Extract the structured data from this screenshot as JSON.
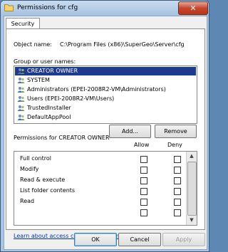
{
  "window": {
    "title": "Permissions for cfg",
    "close_label": "✕"
  },
  "tabs": [
    {
      "label": "Security"
    }
  ],
  "object": {
    "label": "Object name:",
    "value": "C:\\Program Files (x86)\\SuperGeo\\Server\\cfg"
  },
  "groups": {
    "label": "Group or user names:",
    "items": [
      {
        "label": "CREATOR OWNER",
        "icon": "user-group-icon",
        "selected": true
      },
      {
        "label": "SYSTEM",
        "icon": "user-group-icon",
        "selected": false
      },
      {
        "label": "Administrators (EPEI-2008R2-VM\\Administrators)",
        "icon": "user-group-icon",
        "selected": false
      },
      {
        "label": "Users (EPEI-2008R2-VM\\Users)",
        "icon": "user-group-icon",
        "selected": false
      },
      {
        "label": "TrustedInstaller",
        "icon": "user-group-icon",
        "selected": false
      },
      {
        "label": "DefaultAppPool",
        "icon": "user-group-icon",
        "selected": false
      }
    ],
    "add_button": "Add...",
    "remove_button": "Remove"
  },
  "permissions": {
    "label": "Permissions for CREATOR OWNER",
    "allow_header": "Allow",
    "deny_header": "Deny",
    "rows": [
      {
        "name": "Full control",
        "allow": false,
        "deny": false
      },
      {
        "name": "Modify",
        "allow": false,
        "deny": false
      },
      {
        "name": "Read & execute",
        "allow": false,
        "deny": false
      },
      {
        "name": "List folder contents",
        "allow": false,
        "deny": false
      },
      {
        "name": "Read",
        "allow": false,
        "deny": false
      },
      {
        "name": "",
        "allow": false,
        "deny": false
      }
    ]
  },
  "link": "Learn about access control and permissions",
  "footer": {
    "ok": "OK",
    "cancel": "Cancel",
    "apply": "Apply"
  },
  "colors": {
    "selection": "#1e3a8a",
    "link": "#0033cc",
    "close": "#c7452c"
  }
}
